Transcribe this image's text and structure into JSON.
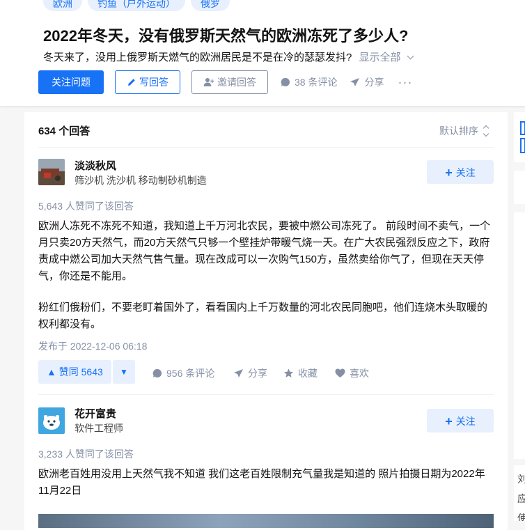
{
  "header": {
    "topics": [
      "欧洲",
      "钓鱼（户外运动）",
      "俄罗"
    ],
    "title": "2022年冬天，没有俄罗斯天然气的欧洲冻死了多少人?",
    "detail": "冬天来了，没用上俄罗斯天燃气的欧洲居民是不是在冷的瑟瑟发抖?",
    "show_all": "显示全部",
    "follow_question": "关注问题",
    "write_answer": "写回答",
    "invite_answer": "邀请回答",
    "comments": "38 条评论",
    "share": "分享",
    "more": "···"
  },
  "answers_header": {
    "count": "634 个回答",
    "sort": "默认排序"
  },
  "answers": [
    {
      "author": "淡淡秋风",
      "bio": "筛沙机 洗沙机 移动制砂机制造",
      "follow": "关注",
      "votes_text": "5,643 人赞同了该回答",
      "paragraphs": [
        "欧洲人冻死不冻死不知道，我知道上千万河北农民，要被中燃公司冻死了。 前段时间不卖气，一个月只卖20方天然气，而20方天然气只够一个壁挂炉带暖气烧一天。在广大农民强烈反应之下，政府责成中燃公司加大天然气售气量。现在改成可以一次购气150方，虽然卖给你气了，但现在天天停气，你还是不能用。",
        "粉红们俄粉们，不要老盯着国外了，看看国内上千万数量的河北农民同胞吧，他们连烧木头取暖的权利都没有。"
      ],
      "published": "发布于 2022-12-06 06:18",
      "vote_up": "赞同 5643",
      "comments": "956 条评论",
      "share": "分享",
      "collect": "收藏",
      "like": "喜欢"
    },
    {
      "author": "花开富贵",
      "bio": "软件工程师",
      "follow": "关注",
      "votes_text": "3,233 人赞同了该回答",
      "paragraphs": [
        "欧洲老百姓用没用上天然气我不知道 我们这老百姓限制充气量我是知道的 照片拍摄日期为2022年11月22日"
      ]
    }
  ],
  "sidebar": {
    "lines": [
      "刘",
      "应",
      "使"
    ]
  },
  "colors": {
    "brand_blue": "#1772f6",
    "light_blue_bg": "#e8f0fd",
    "gray_text": "#8590a6"
  }
}
